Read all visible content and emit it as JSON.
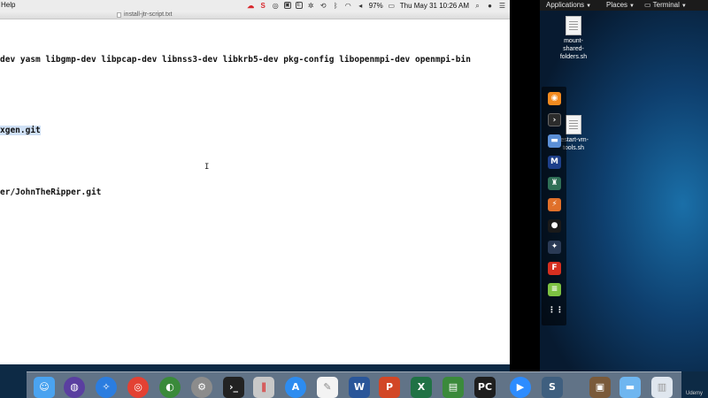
{
  "menubar": {
    "help_label": "Help",
    "battery": "97%",
    "datetime": "Thu May 31  10:26 AM",
    "status_icons": [
      "creative-cloud-icon",
      "scrivener-icon",
      "skype-icon",
      "dropbox-icon",
      "evernote-icon",
      "settings-icon",
      "time-machine-icon",
      "bluetooth-icon",
      "wifi-icon",
      "volume-icon",
      "battery-icon",
      "search-icon",
      "siri-icon",
      "notification-center-icon"
    ]
  },
  "editor": {
    "filename": "install-jtr-script.txt",
    "lines": [
      {
        "text": "dev yasm libgmp-dev libpcap-dev libnss3-dev libkrb5-dev pkg-config libopenmpi-dev openmpi-bin",
        "selected": false
      },
      {
        "text": "xgen.git",
        "selected": true
      },
      {
        "text": "er/JohnTheRipper.git",
        "selected": false
      }
    ],
    "cursor_glyph": "I"
  },
  "kali": {
    "menus": [
      {
        "label": "Applications"
      },
      {
        "label": "Places"
      },
      {
        "label": "Terminal"
      }
    ],
    "desktop_files": [
      {
        "label_line1": "mount-",
        "label_line2": "shared-",
        "label_line3": "folders.sh"
      },
      {
        "label_line1": "restart-vm-",
        "label_line2": "tools.sh",
        "label_line3": ""
      }
    ],
    "dock_icons": [
      "burp-suite-icon",
      "terminal-icon",
      "files-icon",
      "metasploit-icon",
      "armitage-icon",
      "burpsuite-alt-icon",
      "maltego-icon",
      "beef-icon",
      "faraday-icon",
      "leafpad-icon",
      "show-applications-icon"
    ]
  },
  "mac_dock": {
    "apps": [
      "finder-icon",
      "siri-icon",
      "safari-icon",
      "chrome-icon",
      "world-icon",
      "system-preferences-icon",
      "terminal-icon",
      "parallels-icon",
      "app-store-icon",
      "textedit-icon",
      "word-icon",
      "powerpoint-icon",
      "excel-icon",
      "pdf-icon",
      "pycharm-icon",
      "zoom-icon",
      "scrivener-icon",
      "photo-icon",
      "folder-icon",
      "trash-icon"
    ]
  },
  "watermark": "Udemy"
}
